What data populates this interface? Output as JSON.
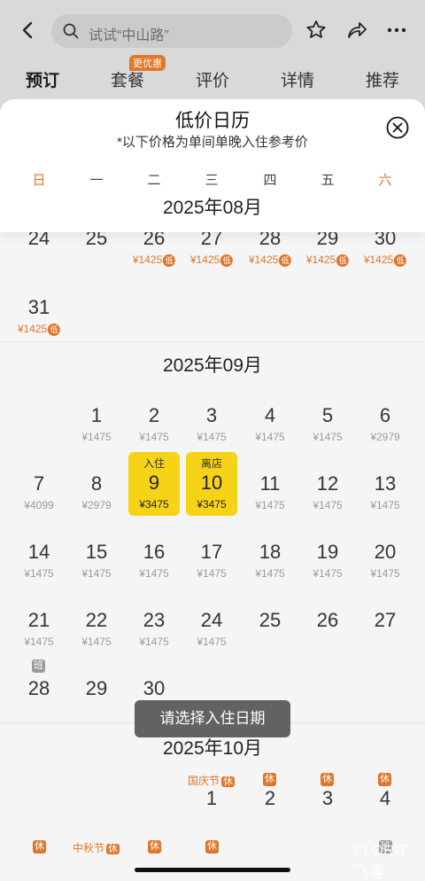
{
  "header": {
    "search_placeholder": "试试“中山路”",
    "tabs": [
      "预订",
      "套餐",
      "评价",
      "详情",
      "推荐"
    ],
    "active_tab": "预订",
    "offer_badge": "更优惠"
  },
  "sheet": {
    "title": "低价日历",
    "subtitle": "*以下价格为单间单晚入住参考价",
    "weekdays": [
      "日",
      "一",
      "二",
      "三",
      "四",
      "五",
      "六"
    ],
    "sticky_month": "2025年08月",
    "low_tag": "低"
  },
  "aug": {
    "row1": [
      {
        "day": "24",
        "price": ""
      },
      {
        "day": "25",
        "price": ""
      },
      {
        "day": "26",
        "price": "¥1425"
      },
      {
        "day": "27",
        "price": "¥1425"
      },
      {
        "day": "28",
        "price": "¥1425"
      },
      {
        "day": "29",
        "price": "¥1425"
      },
      {
        "day": "30",
        "price": "¥1425"
      }
    ],
    "row2": [
      {
        "day": "31",
        "price": "¥1425"
      }
    ]
  },
  "sep": {
    "month": "2025年09月",
    "days": [
      {
        "day": "1",
        "price": "¥1475"
      },
      {
        "day": "2",
        "price": "¥1475"
      },
      {
        "day": "3",
        "price": "¥1475"
      },
      {
        "day": "4",
        "price": "¥1475"
      },
      {
        "day": "5",
        "price": "¥1475"
      },
      {
        "day": "6",
        "price": "¥2979"
      },
      {
        "day": "7",
        "price": "¥4099"
      },
      {
        "day": "8",
        "price": "¥2979"
      },
      {
        "day": "9",
        "price": "¥3475",
        "label": "入住"
      },
      {
        "day": "10",
        "price": "¥3475",
        "label": "离店"
      },
      {
        "day": "11",
        "price": "¥1475"
      },
      {
        "day": "12",
        "price": "¥1475"
      },
      {
        "day": "13",
        "price": "¥1475"
      },
      {
        "day": "14",
        "price": "¥1475"
      },
      {
        "day": "15",
        "price": "¥1475"
      },
      {
        "day": "16",
        "price": "¥1475"
      },
      {
        "day": "17",
        "price": "¥1475"
      },
      {
        "day": "18",
        "price": "¥1475"
      },
      {
        "day": "19",
        "price": "¥1475"
      },
      {
        "day": "20",
        "price": "¥1475"
      },
      {
        "day": "21",
        "price": "¥1475"
      },
      {
        "day": "22",
        "price": "¥1475"
      },
      {
        "day": "23",
        "price": "¥1475"
      },
      {
        "day": "24",
        "price": "¥1475"
      },
      {
        "day": "25",
        "price": ""
      },
      {
        "day": "26",
        "price": ""
      },
      {
        "day": "27",
        "price": ""
      },
      {
        "day": "28",
        "price": "",
        "tag": "班"
      },
      {
        "day": "29",
        "price": ""
      },
      {
        "day": "30",
        "price": ""
      }
    ]
  },
  "oct": {
    "month": "2025年10月",
    "festival_national": "国庆节",
    "festival_midautumn": "中秋节",
    "rest_tag": "休",
    "work_tag": "班",
    "days": [
      "1",
      "2",
      "3",
      "4"
    ]
  },
  "toast": "请选择入住日期",
  "watermark": "FLORIT 飞客"
}
